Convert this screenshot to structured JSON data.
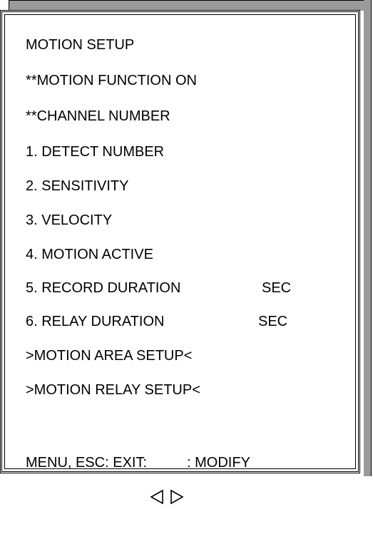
{
  "menu": {
    "title": "MOTION SETUP",
    "function_status": "**MOTION FUNCTION ON",
    "channel_number": "**CHANNEL NUMBER",
    "items": [
      {
        "label": "1. DETECT NUMBER",
        "unit": ""
      },
      {
        "label": "2. SENSITIVITY",
        "unit": ""
      },
      {
        "label": "3. VELOCITY",
        "unit": ""
      },
      {
        "label": "4. MOTION ACTIVE",
        "unit": ""
      },
      {
        "label": "5. RECORD DURATION",
        "unit": "SEC"
      },
      {
        "label": "6. RELAY DURATION",
        "unit": "SEC"
      }
    ],
    "submenus": [
      ">MOTION AREA SETUP<",
      ">MOTION RELAY SETUP<"
    ]
  },
  "footer": {
    "exit_text": "MENU, ESC: EXIT:",
    "modify_text": ": MODIFY",
    "left_icon": "left-triangle-icon",
    "right_icon": "right-triangle-icon"
  }
}
